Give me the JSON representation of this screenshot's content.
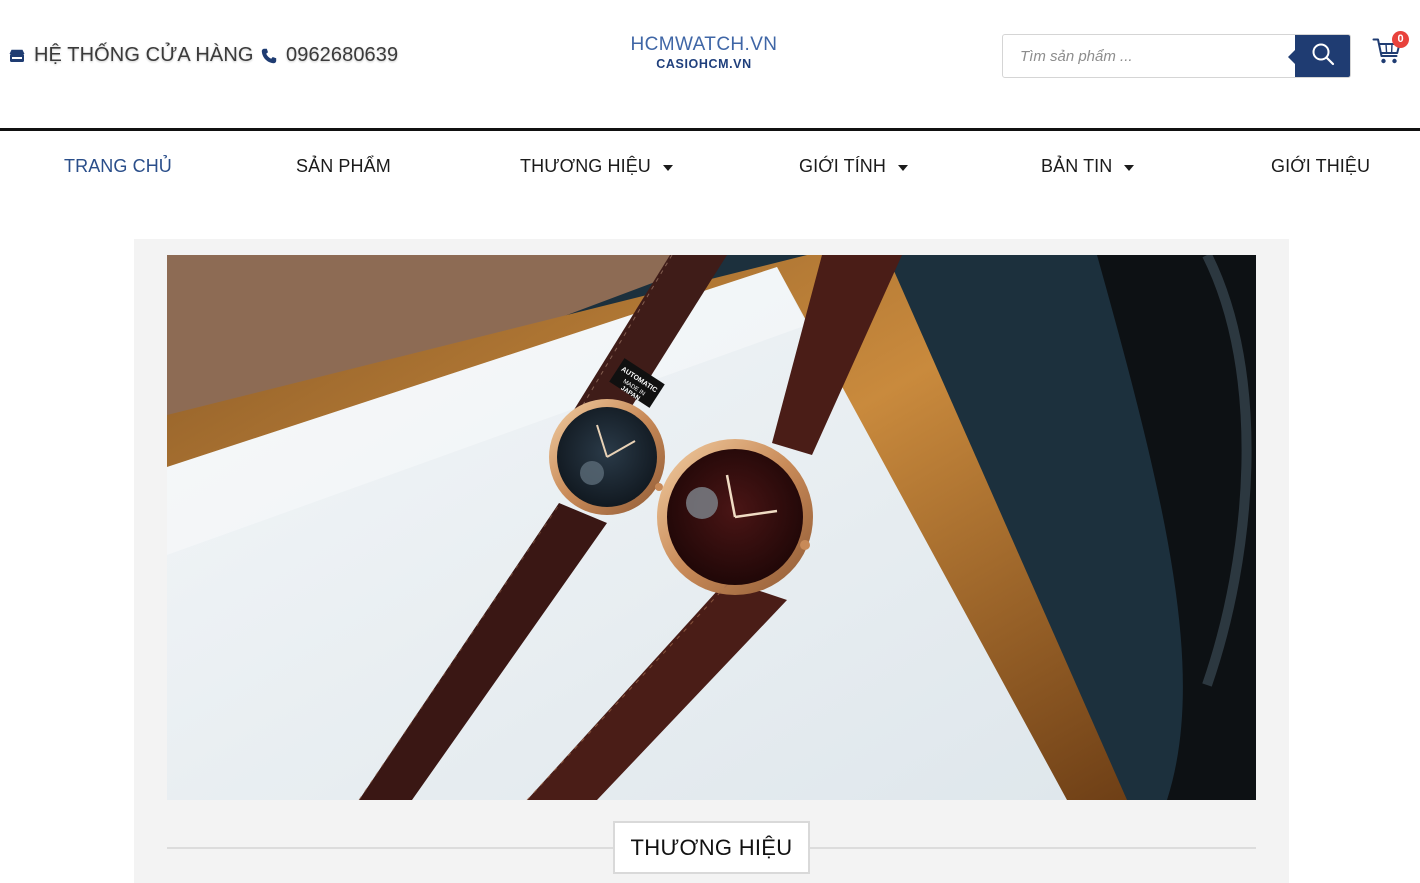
{
  "header": {
    "store_label": "HỆ THỐNG CỬA HÀNG",
    "phone": "0962680639",
    "logo_line1": "HCMWATCH.VN",
    "logo_line2": "CASIOHCM.VN",
    "search_placeholder": "Tìm sản phẩm ...",
    "cart_count": "0"
  },
  "nav": {
    "items": [
      {
        "label": "TRANG CHỦ",
        "active": true,
        "dropdown": false
      },
      {
        "label": "SẢN PHẨM",
        "active": false,
        "dropdown": false
      },
      {
        "label": "THƯƠNG HIỆU",
        "active": false,
        "dropdown": true
      },
      {
        "label": "GIỚI TÍNH",
        "active": false,
        "dropdown": true
      },
      {
        "label": "BẢN TIN",
        "active": false,
        "dropdown": true
      },
      {
        "label": "GIỚI THIỆU",
        "active": false,
        "dropdown": false
      }
    ]
  },
  "hero": {
    "strap_tag": "AUTOMATIC MADE IN JAPAN"
  },
  "section": {
    "title": "THƯƠNG HIỆU"
  },
  "colors": {
    "accent": "#1f3c72",
    "active_nav": "#2a4e8a",
    "badge": "#e8423c",
    "panel_bg": "#f3f3f3"
  },
  "icons": {
    "store": "store-icon",
    "phone": "phone-icon",
    "search": "search-icon",
    "cart": "cart-icon",
    "caret": "caret-down-icon"
  }
}
